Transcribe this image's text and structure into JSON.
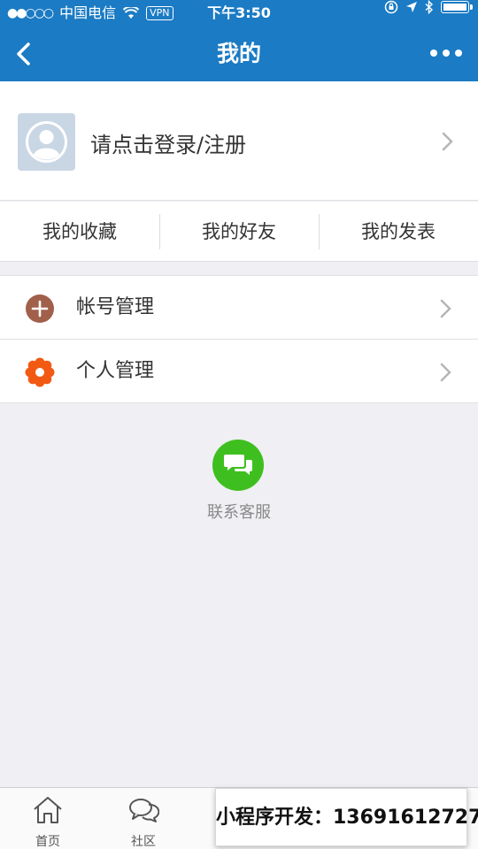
{
  "status_bar": {
    "signal": "●●○○○",
    "carrier": "中国电信",
    "vpn": "VPN",
    "time": "下午3:50"
  },
  "nav": {
    "title": "我的"
  },
  "profile": {
    "login_text": "请点击登录/注册"
  },
  "shortcuts": [
    {
      "label": "我的收藏"
    },
    {
      "label": "我的好友"
    },
    {
      "label": "我的发表"
    }
  ],
  "menu": [
    {
      "label": "帐号管理",
      "icon": "plus-circle-icon",
      "color": "#a0604a"
    },
    {
      "label": "个人管理",
      "icon": "gear-flower-icon",
      "color": "#f25a13"
    }
  ],
  "service": {
    "label": "联系客服",
    "icon": "chat-bubbles-icon",
    "color": "#3fbf1f"
  },
  "tabbar": {
    "tabs": [
      {
        "label": "首页",
        "icon": "home-icon"
      },
      {
        "label": "社区",
        "icon": "chat-icon"
      }
    ]
  },
  "promo": {
    "text": "小程序开发：13691612727"
  },
  "colors": {
    "accent": "#1b7bc4",
    "background": "#efeff4"
  }
}
